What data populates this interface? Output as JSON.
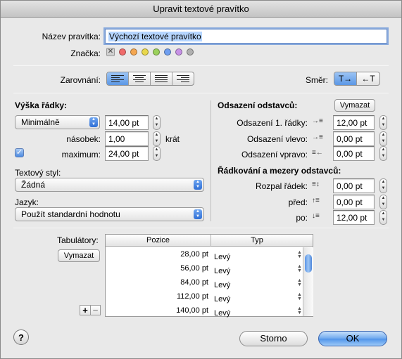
{
  "window": {
    "title": "Upravit textové pravítko"
  },
  "name": {
    "label": "Název pravítka:",
    "value": "Výchozí textové pravítko"
  },
  "tag": {
    "label": "Značka:",
    "colors": [
      "#f06b6b",
      "#f4a650",
      "#e8d74c",
      "#9bd15c",
      "#6f9ff0",
      "#c792e6",
      "#b0b0b0"
    ]
  },
  "alignment": {
    "label": "Zarovnání:"
  },
  "direction": {
    "label": "Směr:"
  },
  "line_height": {
    "heading": "Výška řádky:",
    "mode": "Minimálně",
    "value": "14,00 pt",
    "multiplier_label": "násobek:",
    "multiplier_value": "1,00",
    "multiplier_unit": "krát",
    "max_label": "maximum:",
    "max_value": "24,00 pt"
  },
  "text_style": {
    "label": "Textový styl:",
    "value": "Žádná"
  },
  "language": {
    "label": "Jazyk:",
    "value": "Použít standardní hodnotu"
  },
  "indents": {
    "heading": "Odsazení odstavců:",
    "clear_button": "Vymazat",
    "first_line_label": "Odsazení 1. řádky:",
    "first_line_value": "12,00 pt",
    "left_label": "Odsazení vlevo:",
    "left_value": "0,00 pt",
    "right_label": "Odsazení vpravo:",
    "right_value": "0,00 pt"
  },
  "spacing": {
    "heading": "Řádkování a mezery odstavců:",
    "line_label": "Rozpal řádek:",
    "line_value": "0,00 pt",
    "before_label": "před:",
    "before_value": "0,00 pt",
    "after_label": "po:",
    "after_value": "12,00 pt"
  },
  "tabs": {
    "label": "Tabulátory:",
    "clear_button": "Vymazat",
    "columns": [
      "Pozice",
      "Typ"
    ],
    "rows": [
      {
        "position": "28,00 pt",
        "type": "Levý"
      },
      {
        "position": "56,00 pt",
        "type": "Levý"
      },
      {
        "position": "84,00 pt",
        "type": "Levý"
      },
      {
        "position": "112,00 pt",
        "type": "Levý"
      },
      {
        "position": "140,00 pt",
        "type": "Levý"
      }
    ],
    "add": "+",
    "remove": "−"
  },
  "buttons": {
    "help": "?",
    "cancel": "Storno",
    "ok": "OK"
  }
}
